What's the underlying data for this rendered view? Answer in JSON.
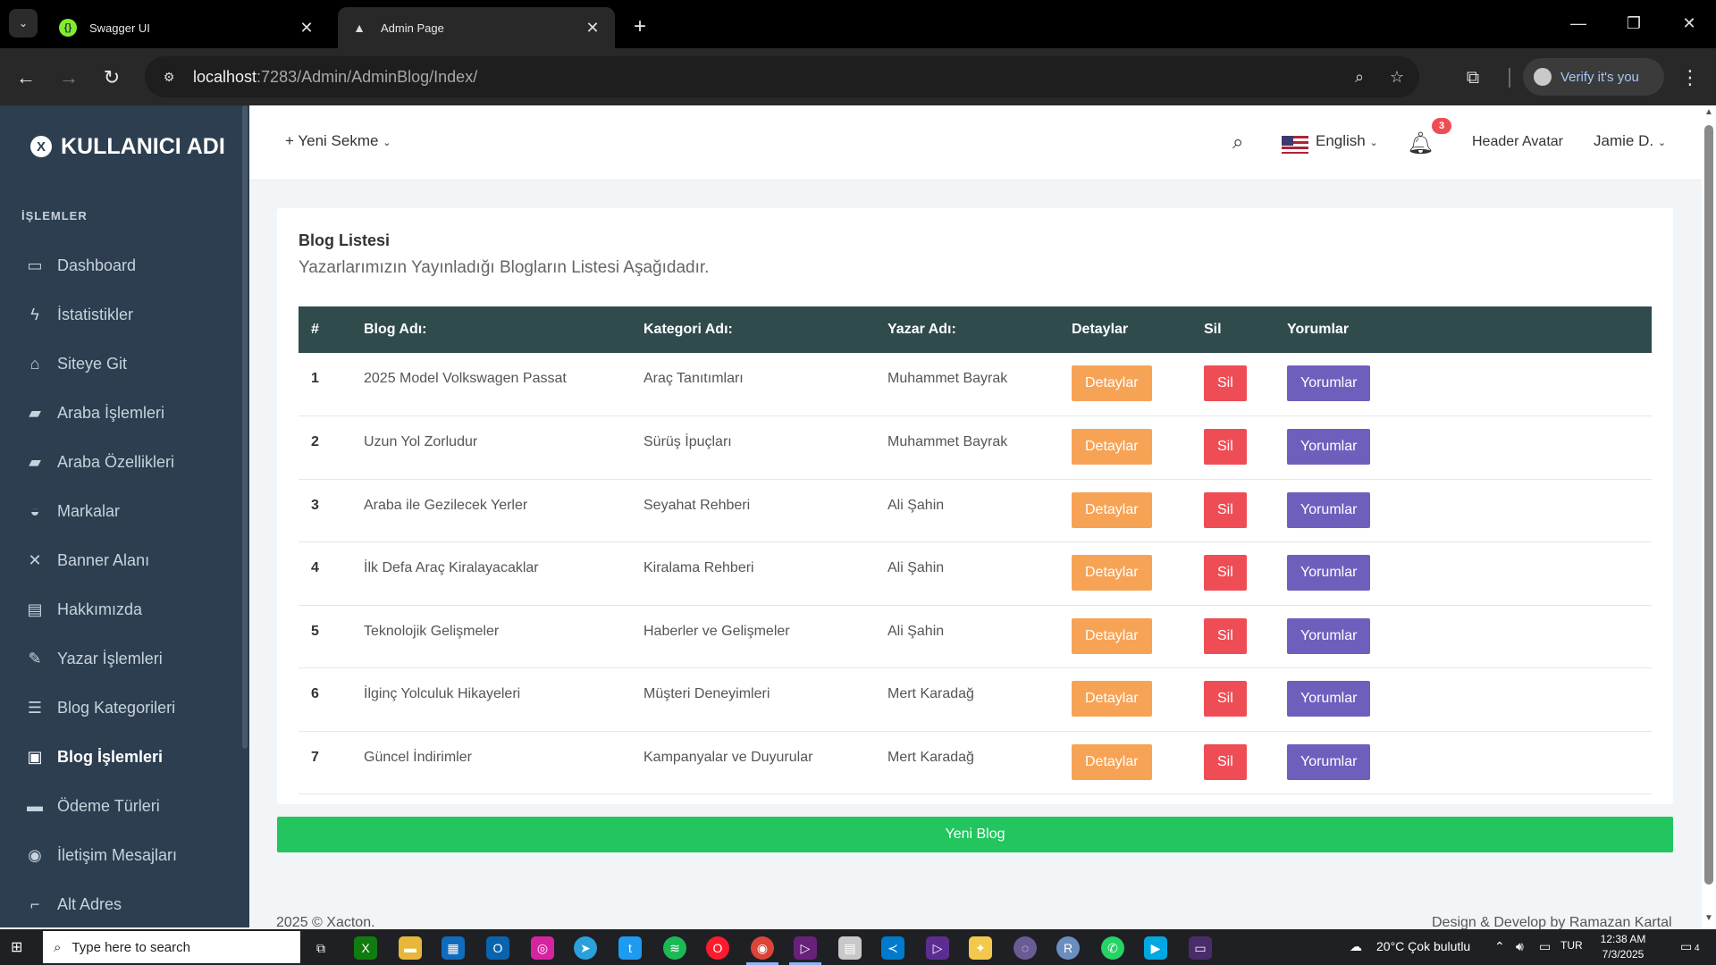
{
  "browser": {
    "tabs": [
      {
        "title": "Swagger UI",
        "active": false
      },
      {
        "title": "Admin Page",
        "active": true
      }
    ],
    "url_host": "localhost",
    "url_path": ":7283/Admin/AdminBlog/Index/",
    "verify_label": "Verify it's you"
  },
  "sidebar": {
    "brand": "KULLANICI ADI",
    "section_title": "İŞLEMLER",
    "items": [
      {
        "label": "Dashboard",
        "icon": "monitor-icon",
        "glyph": "▭"
      },
      {
        "label": "İstatistikler",
        "icon": "bolt-icon",
        "glyph": "ϟ"
      },
      {
        "label": "Siteye Git",
        "icon": "home-icon",
        "glyph": "⌂"
      },
      {
        "label": "Araba İşlemleri",
        "icon": "car-icon",
        "glyph": "▰"
      },
      {
        "label": "Araba Özellikleri",
        "icon": "car-side-icon",
        "glyph": "▰"
      },
      {
        "label": "Markalar",
        "icon": "car-front-icon",
        "glyph": "◒"
      },
      {
        "label": "Banner Alanı",
        "icon": "arrows-expand-icon",
        "glyph": "✕"
      },
      {
        "label": "Hakkımızda",
        "icon": "file-icon",
        "glyph": "▤"
      },
      {
        "label": "Yazar İşlemleri",
        "icon": "pencil-icon",
        "glyph": "✎"
      },
      {
        "label": "Blog Kategorileri",
        "icon": "list-icon",
        "glyph": "☰"
      },
      {
        "label": "Blog İşlemleri",
        "icon": "blog-icon",
        "glyph": "▣",
        "active": true
      },
      {
        "label": "Ödeme Türleri",
        "icon": "money-icon",
        "glyph": "▬"
      },
      {
        "label": "İletişim Mesajları",
        "icon": "chat-icon",
        "glyph": "◉"
      },
      {
        "label": "Alt Adres",
        "icon": "crop-icon",
        "glyph": "⌐"
      }
    ]
  },
  "header": {
    "new_tab": "+ Yeni Sekme",
    "language": "English",
    "notification_count": "3",
    "avatar_alt": "Header Avatar",
    "user_name": "Jamie D."
  },
  "main": {
    "title": "Blog Listesi",
    "subtitle": "Yazarlarımızın Yayınladığı Blogların Listesi Aşağıdadır.",
    "columns": [
      "#",
      "Blog Adı:",
      "Kategori Adı:",
      "Yazar Adı:",
      "Detaylar",
      "Sil",
      "Yorumlar"
    ],
    "rows": [
      {
        "num": "1",
        "blog": "2025 Model Volkswagen Passat",
        "category": "Araç Tanıtımları",
        "author": "Muhammet Bayrak"
      },
      {
        "num": "2",
        "blog": "Uzun Yol Zorludur",
        "category": "Sürüş İpuçları",
        "author": "Muhammet Bayrak"
      },
      {
        "num": "3",
        "blog": "Araba ile Gezilecek Yerler",
        "category": "Seyahat Rehberi",
        "author": "Ali Şahin"
      },
      {
        "num": "4",
        "blog": "İlk Defa Araç Kiralayacaklar",
        "category": "Kiralama Rehberi",
        "author": "Ali Şahin"
      },
      {
        "num": "5",
        "blog": "Teknolojik Gelişmeler",
        "category": "Haberler ve Gelişmeler",
        "author": "Ali Şahin"
      },
      {
        "num": "6",
        "blog": "İlginç Yolculuk Hikayeleri",
        "category": "Müşteri Deneyimleri",
        "author": "Mert Karadağ"
      },
      {
        "num": "7",
        "blog": "Güncel İndirimler",
        "category": "Kampanyalar ve Duyurular",
        "author": "Mert Karadağ"
      }
    ],
    "btn_details": "Detaylar",
    "btn_delete": "Sil",
    "btn_comments": "Yorumlar",
    "btn_new_blog": "Yeni Blog"
  },
  "footer": {
    "left": "2025 © Xacton.",
    "right": "Design & Develop by Ramazan Kartal"
  },
  "taskbar": {
    "search_placeholder": "Type here to search",
    "weather": "20°C  Çok bulutlu",
    "language": "TUR",
    "time": "12:38 AM",
    "date": "7/3/2025",
    "notification_count": "4"
  },
  "colors": {
    "sidebar_bg": "#2c3e50",
    "table_header_bg": "#2f4b4c",
    "details_btn": "#f7a356",
    "delete_btn": "#ef4d56",
    "comments_btn": "#6f5fbd",
    "new_blog_btn": "#22c55e"
  }
}
